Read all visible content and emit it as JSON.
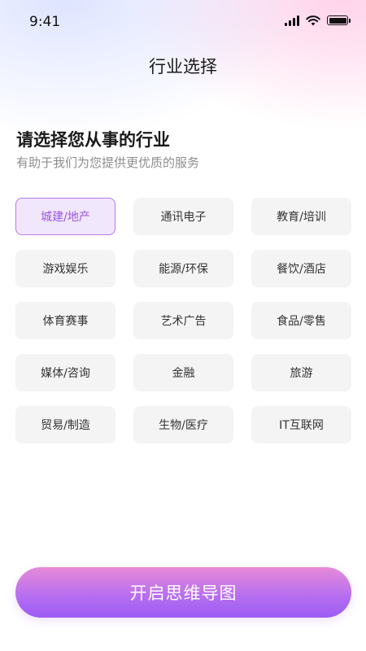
{
  "status_bar": {
    "time": "9:41"
  },
  "header": {
    "title": "行业选择"
  },
  "intro": {
    "heading": "请选择您从事的行业",
    "subheading": "有助于我们为您提供更优质的服务"
  },
  "industries": [
    {
      "label": "城建/地产",
      "selected": true
    },
    {
      "label": "通讯电子",
      "selected": false
    },
    {
      "label": "教育/培训",
      "selected": false
    },
    {
      "label": "游戏娱乐",
      "selected": false
    },
    {
      "label": "能源/环保",
      "selected": false
    },
    {
      "label": "餐饮/酒店",
      "selected": false
    },
    {
      "label": "体育赛事",
      "selected": false
    },
    {
      "label": "艺术广告",
      "selected": false
    },
    {
      "label": "食品/零售",
      "selected": false
    },
    {
      "label": "媒体/咨询",
      "selected": false
    },
    {
      "label": "金融",
      "selected": false
    },
    {
      "label": "旅游",
      "selected": false
    },
    {
      "label": "贸易/制造",
      "selected": false
    },
    {
      "label": "生物/医疗",
      "selected": false
    },
    {
      "label": "IT互联网",
      "selected": false
    }
  ],
  "primary_action": {
    "label": "开启思维导图"
  },
  "colors": {
    "accent": "#9a55e0",
    "selected_bg": "#f1e7fd",
    "button_gradient_start": "#e78ad8",
    "button_gradient_end": "#9d5cf2"
  },
  "icons": [
    "cellular-signal-icon",
    "wifi-icon",
    "battery-icon"
  ]
}
